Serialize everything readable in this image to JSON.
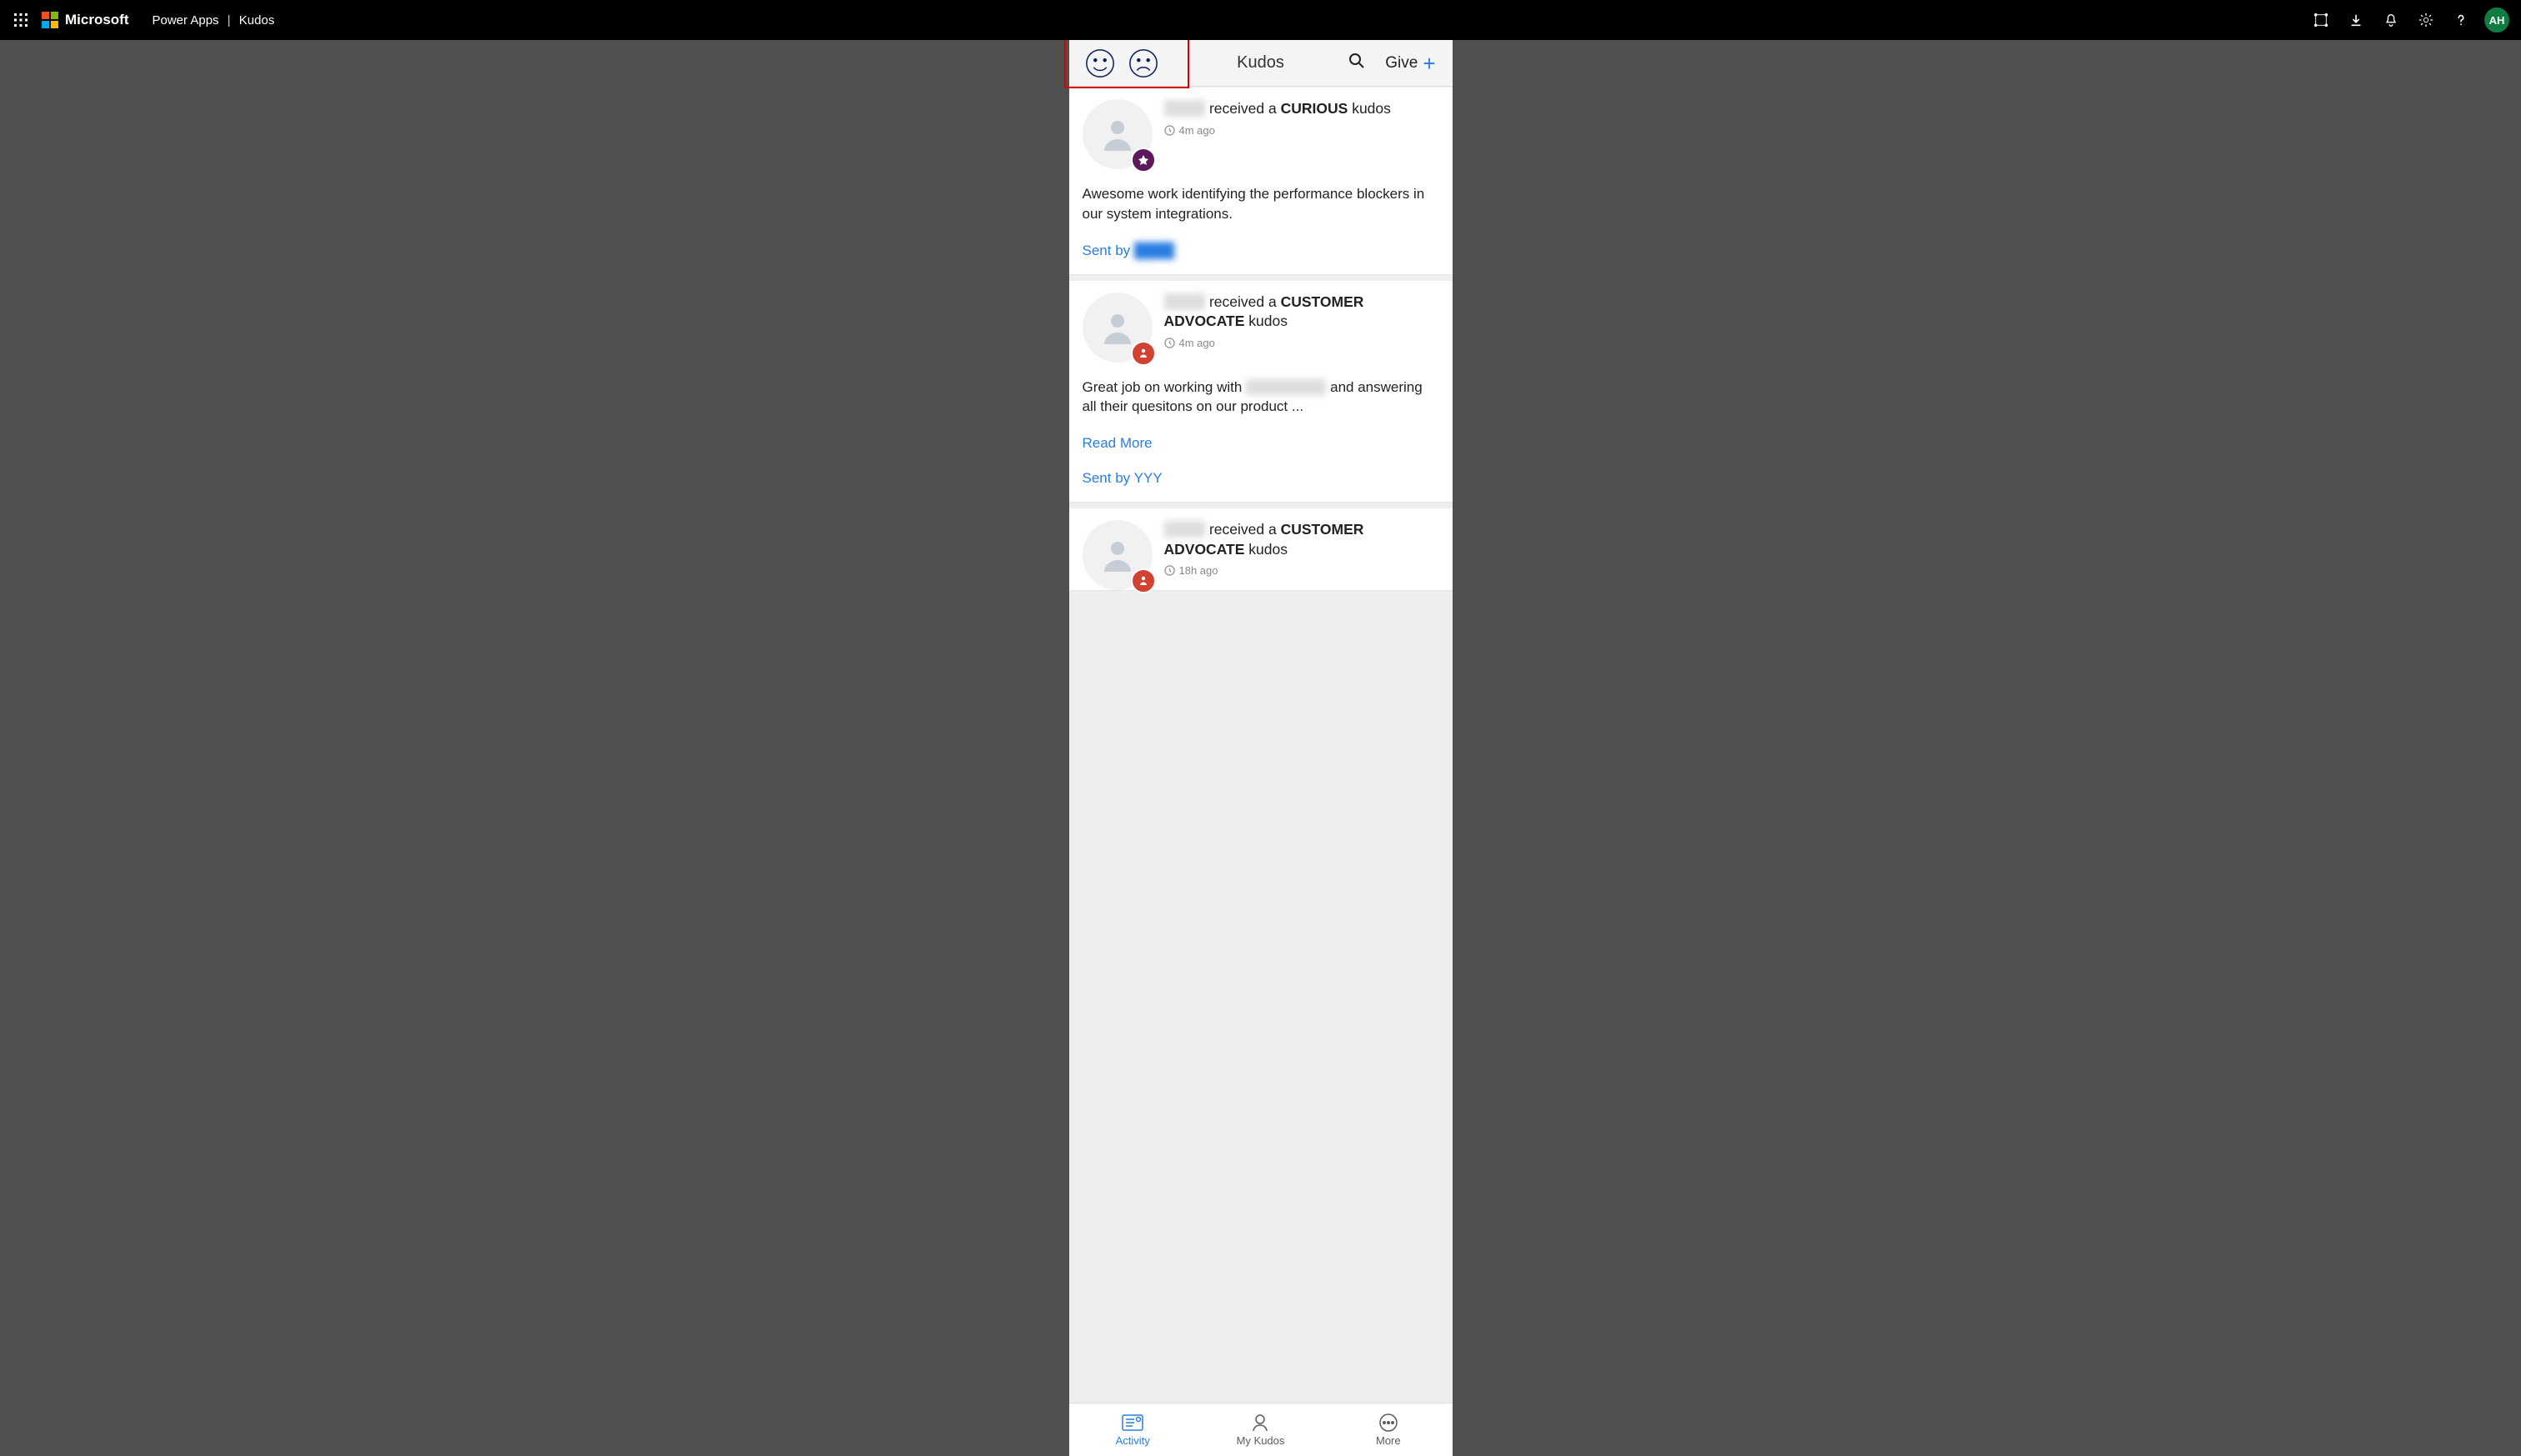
{
  "topbar": {
    "brand": "Microsoft",
    "breadcrumb_app": "Power Apps",
    "breadcrumb_sep": "|",
    "breadcrumb_page": "Kudos",
    "avatar_initials": "AH"
  },
  "app": {
    "title": "Kudos",
    "give_label": "Give"
  },
  "feed": [
    {
      "recipient_hidden": "████",
      "received_a": "received a",
      "kudos_type": "CURIOUS",
      "kudos_suffix": "kudos",
      "time": "4m ago",
      "body": "Awesome work identifying the performance blockers in our system integrations.",
      "sent_by_prefix": "Sent by",
      "sent_by": "████",
      "badge": "purple"
    },
    {
      "recipient_hidden": "████",
      "received_a": "received a",
      "kudos_type": "CUSTOMER ADVOCATE",
      "kudos_suffix": "kudos",
      "time": "4m ago",
      "body_pre": "Great job on working with ",
      "body_hidden": "████████",
      "body_post": " and answering all their quesitons on our product ...",
      "read_more": "Read More",
      "sent_by_prefix": "Sent by",
      "sent_by": "YYY",
      "badge": "red"
    },
    {
      "recipient_hidden": "████",
      "received_a": "received a",
      "kudos_type": "CUSTOMER ADVOCATE",
      "kudos_suffix": "kudos",
      "time": "18h ago",
      "badge": "red"
    }
  ],
  "tabs": {
    "activity": "Activity",
    "mykudos": "My Kudos",
    "more": "More"
  }
}
